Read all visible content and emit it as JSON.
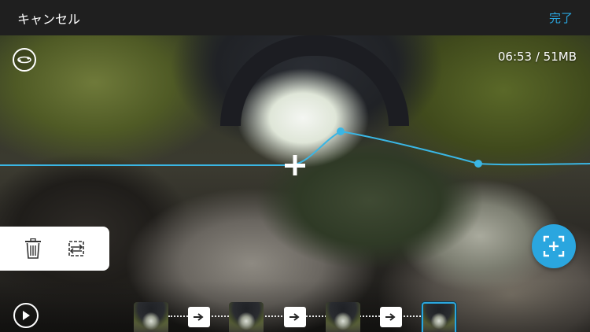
{
  "header": {
    "cancel_label": "キャンセル",
    "done_label": "完了"
  },
  "viewer": {
    "info": "06:53 / 51MB"
  },
  "icons": {
    "sphere": "360-sphere-icon",
    "trash": "trash-icon",
    "flip": "flip-frame-icon",
    "crop": "reframe-plus-icon",
    "play": "play-icon",
    "arrow": "arrow-right-icon"
  },
  "colors": {
    "accent": "#2aa6df",
    "path": "#3ab6e4",
    "topbar": "#1f1f1f"
  }
}
